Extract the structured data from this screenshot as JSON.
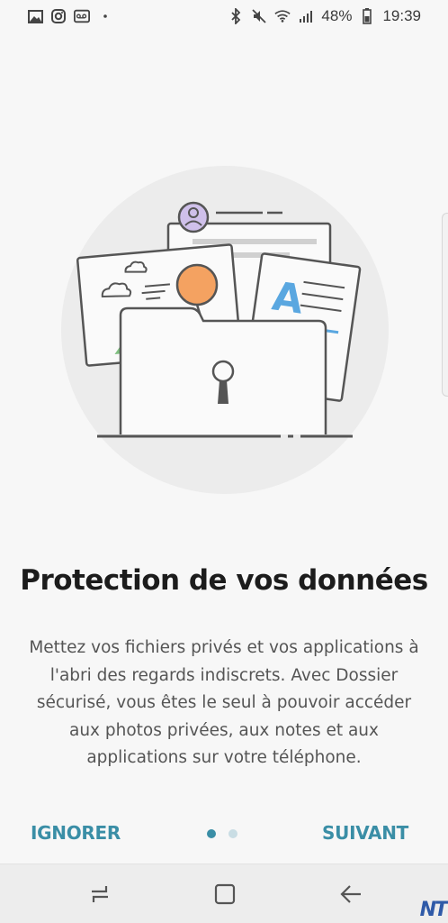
{
  "status_bar": {
    "battery": "48%",
    "time": "19:39",
    "left_icons": [
      "image-icon",
      "instagram-icon",
      "voicemail-icon",
      "dot-icon"
    ],
    "right_icons": [
      "bluetooth-icon",
      "mute-icon",
      "wifi-icon",
      "signal-icon",
      "battery-icon"
    ]
  },
  "onboarding": {
    "title": "Protection de vos données",
    "description": "Mettez vos fichiers privés et vos applications à l'abri des regards indiscrets. Avec Dossier sécurisé, vous êtes le seul à pouvoir accéder aux photos privées, aux notes et aux applications sur votre téléphone.",
    "illustration_icon": "secure-folder-illustration",
    "page_index": 1,
    "page_count": 2
  },
  "actions": {
    "ignore_label": "IGNORER",
    "next_label": "SUIVANT"
  },
  "navigation_bar": {
    "icons": [
      "recent-apps-icon",
      "home-icon",
      "back-icon"
    ]
  },
  "watermark": "NT",
  "colors": {
    "accent": "#3a8ea6",
    "background": "#f7f7f7",
    "illustration_orange": "#f4a261",
    "illustration_blue": "#5aa7e0",
    "illustration_green": "#7fbf7f",
    "illustration_purple": "#c9b6e6"
  }
}
